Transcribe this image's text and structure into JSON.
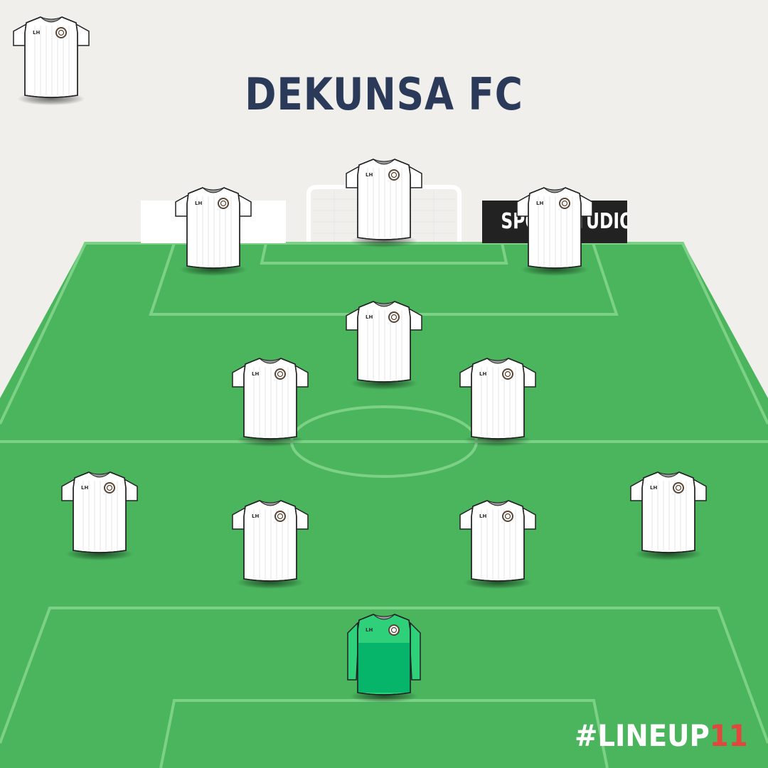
{
  "team": {
    "name": "DEKUNSA FC"
  },
  "boards": {
    "left_text": "",
    "right_text": "SPORTSTUDIO"
  },
  "kit": {
    "outfield_color": "#ffffff",
    "goalkeeper_color": "#2ed17a",
    "goalkeeper_lower_color": "#06b46a",
    "sponsor_text": "LH",
    "pitch_color": "#4ab55d",
    "line_color": "#7cd187",
    "title_color": "#2c3a5a"
  },
  "formation": {
    "players": [
      {
        "role": "bench-kit",
        "kit": "outfield"
      },
      {
        "role": "striker",
        "kit": "outfield"
      },
      {
        "role": "left-forward",
        "kit": "outfield"
      },
      {
        "role": "right-forward",
        "kit": "outfield"
      },
      {
        "role": "attacking-midfielder",
        "kit": "outfield"
      },
      {
        "role": "left-central-midfielder",
        "kit": "outfield"
      },
      {
        "role": "right-central-midfielder",
        "kit": "outfield"
      },
      {
        "role": "left-back",
        "kit": "outfield"
      },
      {
        "role": "left-centre-back",
        "kit": "outfield"
      },
      {
        "role": "right-centre-back",
        "kit": "outfield"
      },
      {
        "role": "right-back",
        "kit": "outfield"
      },
      {
        "role": "goalkeeper",
        "kit": "goalkeeper"
      }
    ]
  },
  "hashtag": {
    "main": "#LINEUP",
    "accent": "11"
  }
}
